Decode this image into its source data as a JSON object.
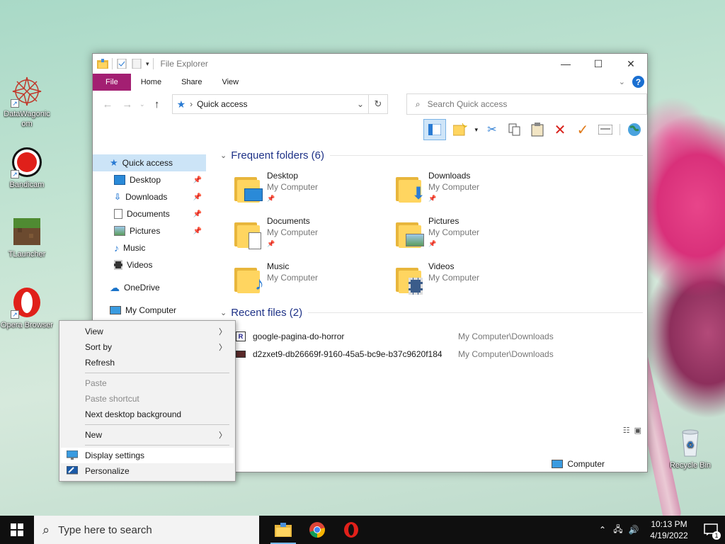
{
  "desktop": {
    "icons": [
      {
        "label": "DataWagonic om"
      },
      {
        "label": "Bandicam"
      },
      {
        "label": "TLauncher"
      },
      {
        "label": "Opera Browser"
      },
      {
        "label": "Recycle Bin"
      }
    ]
  },
  "explorer": {
    "title": "File Explorer",
    "ribbon_tabs": [
      "File",
      "Home",
      "Share",
      "View"
    ],
    "help_label": "?",
    "address": "Quick access",
    "search_placeholder": "Search Quick access",
    "nav": {
      "quick_access": "Quick access",
      "items": [
        "Desktop",
        "Downloads",
        "Documents",
        "Pictures",
        "Music",
        "Videos"
      ],
      "onedrive": "OneDrive",
      "my_computer": "My Computer"
    },
    "frequent_header": "Frequent folders (6)",
    "folders": [
      {
        "name": "Desktop",
        "loc": "My Computer",
        "pinned": true
      },
      {
        "name": "Downloads",
        "loc": "My Computer",
        "pinned": true
      },
      {
        "name": "Documents",
        "loc": "My Computer",
        "pinned": true
      },
      {
        "name": "Pictures",
        "loc": "My Computer",
        "pinned": true
      },
      {
        "name": "Music",
        "loc": "My Computer",
        "pinned": false
      },
      {
        "name": "Videos",
        "loc": "My Computer",
        "pinned": false
      }
    ],
    "recent_header": "Recent files (2)",
    "files": [
      {
        "name": "google-pagina-do-horror",
        "loc": "My Computer\\Downloads"
      },
      {
        "name": "d2zxet9-db26669f-9160-45a5-bc9e-b37c9620f184",
        "loc": "My Computer\\Downloads"
      }
    ],
    "status_location": "Computer"
  },
  "context_menu": {
    "view": "View",
    "sort_by": "Sort by",
    "refresh": "Refresh",
    "paste": "Paste",
    "paste_shortcut": "Paste shortcut",
    "next_bg": "Next desktop background",
    "new": "New",
    "display_settings": "Display settings",
    "personalize": "Personalize"
  },
  "taskbar": {
    "search_placeholder": "Type here to search",
    "time": "10:13 PM",
    "date": "4/19/2022",
    "notification_count": "1"
  },
  "colors": {
    "file_tab": "#a31f72",
    "selection": "#cce4f7",
    "accent": "#1a6fd1"
  }
}
